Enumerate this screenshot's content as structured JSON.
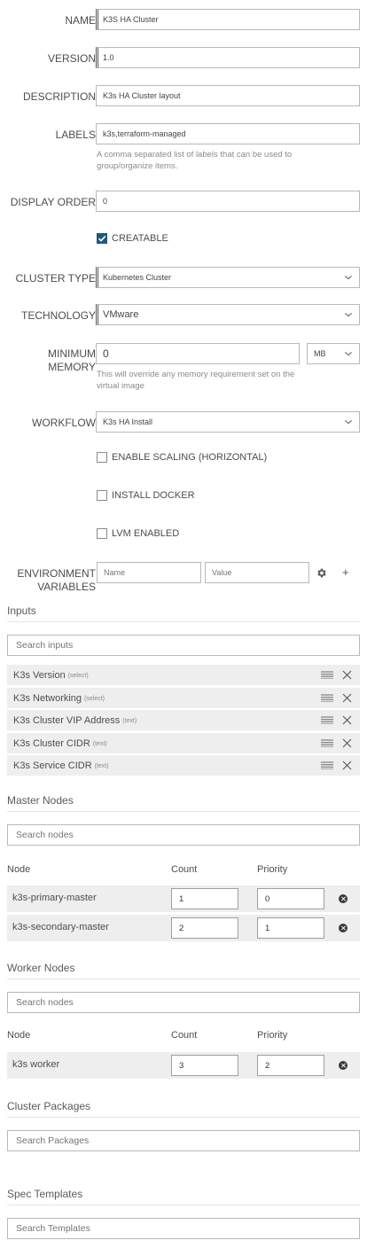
{
  "form": {
    "name": {
      "label": "NAME",
      "value": "K3S HA Cluster"
    },
    "version": {
      "label": "VERSION",
      "value": "1.0"
    },
    "description": {
      "label": "DESCRIPTION",
      "value": "K3s HA Cluster layout"
    },
    "labels": {
      "label": "LABELS",
      "value": "k3s,terraform-managed",
      "help": "A comma separated list of labels that can be used to group/organize items."
    },
    "display_order": {
      "label": "DISPLAY ORDER",
      "value": "0"
    },
    "creatable": {
      "label": "CREATABLE",
      "checked": true
    },
    "cluster_type": {
      "label": "CLUSTER TYPE",
      "value": "Kubernetes Cluster"
    },
    "technology": {
      "label": "TECHNOLOGY",
      "value": "VMware"
    },
    "minimum_memory": {
      "label_line1": "MINIMUM",
      "label_line2": "MEMORY",
      "value": "0",
      "unit": "MB",
      "help": "This will override any memory requirement set on the virtual image"
    },
    "workflow": {
      "label": "WORKFLOW",
      "value": "K3s HA Install"
    },
    "enable_scaling": {
      "label": "ENABLE SCALING (HORIZONTAL)",
      "checked": false
    },
    "install_docker": {
      "label": "INSTALL DOCKER",
      "checked": false
    },
    "lvm_enabled": {
      "label": "LVM ENABLED",
      "checked": false
    },
    "env_vars": {
      "label_line1": "ENVIRONMENT",
      "label_line2": "VARIABLES",
      "name_placeholder": "Name",
      "value_placeholder": "Value",
      "add_label": "+"
    }
  },
  "inputs": {
    "title": "Inputs",
    "search_placeholder": "Search inputs",
    "items": [
      {
        "name": "K3s Version",
        "type": "(select)"
      },
      {
        "name": "K3s Networking",
        "type": "(select)"
      },
      {
        "name": "K3s Cluster VIP Address",
        "type": "(text)"
      },
      {
        "name": "K3s Cluster CIDR",
        "type": "(text)"
      },
      {
        "name": "K3s Service CIDR",
        "type": "(text)"
      }
    ]
  },
  "master_nodes": {
    "title": "Master Nodes",
    "search_placeholder": "Search nodes",
    "columns": {
      "node": "Node",
      "count": "Count",
      "priority": "Priority"
    },
    "rows": [
      {
        "node": "k3s-primary-master",
        "count": "1",
        "priority": "0"
      },
      {
        "node": "k3s-secondary-master",
        "count": "2",
        "priority": "1"
      }
    ]
  },
  "worker_nodes": {
    "title": "Worker Nodes",
    "search_placeholder": "Search nodes",
    "columns": {
      "node": "Node",
      "count": "Count",
      "priority": "Priority"
    },
    "rows": [
      {
        "node": "k3s worker",
        "count": "3",
        "priority": "2"
      }
    ]
  },
  "cluster_packages": {
    "title": "Cluster Packages",
    "search_placeholder": "Search Packages"
  },
  "spec_templates": {
    "title": "Spec Templates",
    "search_placeholder": "Search Templates"
  },
  "colors": {
    "check_on": "#1d5a82",
    "row_bg": "#eeeeee",
    "border": "#b9b9b9"
  }
}
